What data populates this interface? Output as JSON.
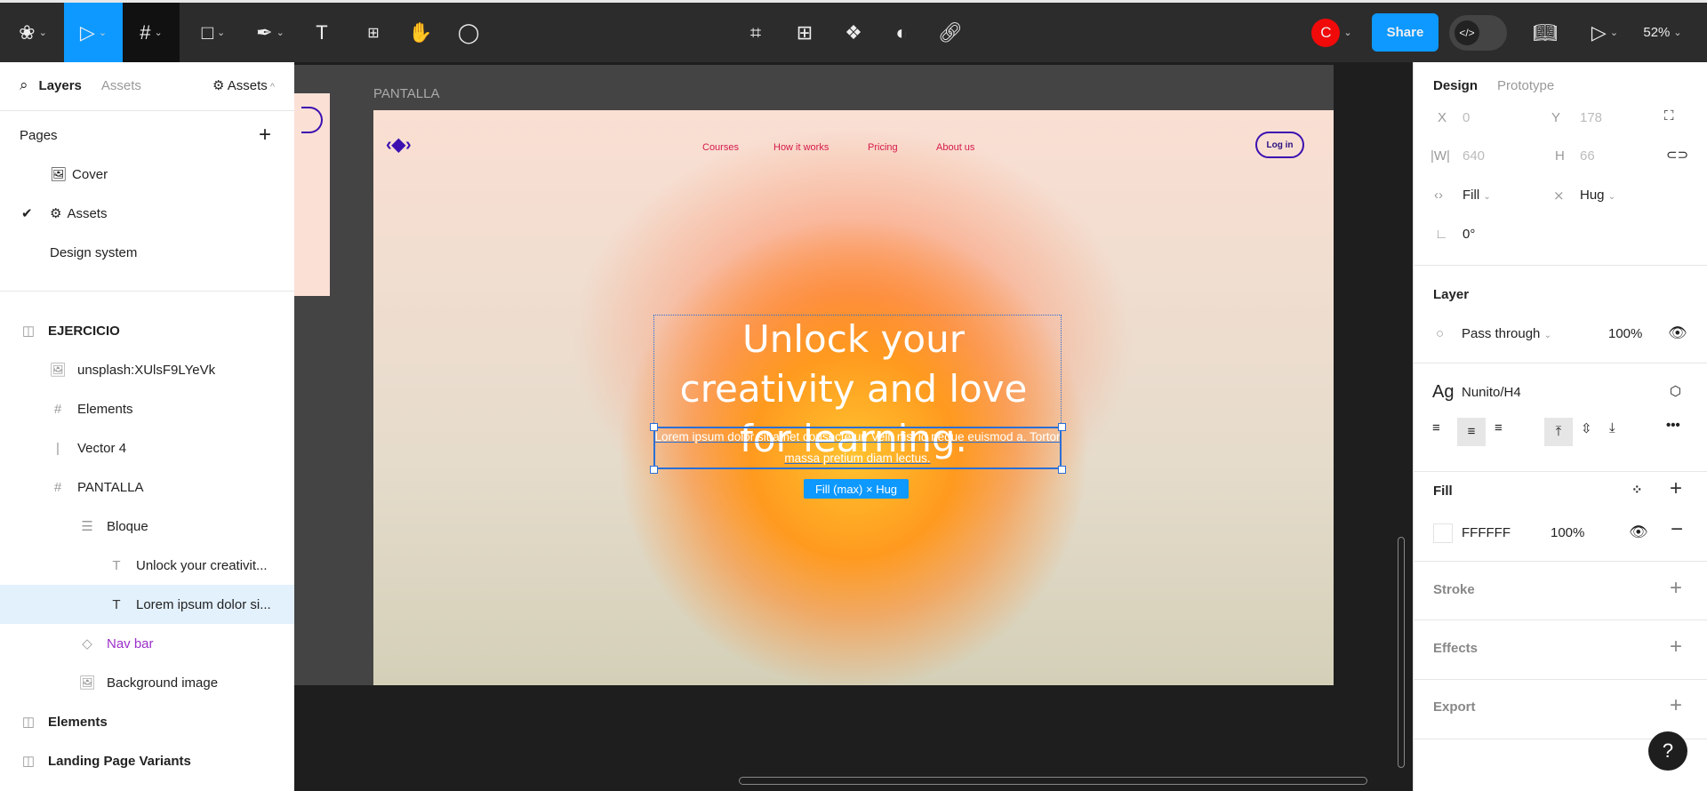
{
  "toolbar": {
    "zoom": "52%",
    "share": "Share",
    "avatar_initial": "C",
    "accent": "#0d99ff",
    "avatar_color": "#f00a0a"
  },
  "left": {
    "tabs": {
      "layers": "Layers",
      "assets": "Assets",
      "assets_dropdown": "Assets"
    },
    "pages_title": "Pages",
    "pages": [
      {
        "label": "Cover",
        "icon": "image-icon"
      },
      {
        "label": "Assets",
        "icon": "gear-icon",
        "active": true
      },
      {
        "label": "Design system"
      }
    ],
    "layers": [
      {
        "label": "EJERCICIO",
        "icon": "section-icon",
        "depth": 0,
        "bold": true
      },
      {
        "label": "unsplash:XUlsF9LYeVk",
        "icon": "image-icon",
        "depth": 1
      },
      {
        "label": "Elements",
        "icon": "frame-icon",
        "depth": 1
      },
      {
        "label": "Vector 4",
        "icon": "line-icon",
        "depth": 1
      },
      {
        "label": "PANTALLA",
        "icon": "frame-icon",
        "depth": 1
      },
      {
        "label": "Bloque",
        "icon": "autolayout-icon",
        "depth": 2
      },
      {
        "label": "Unlock your creativit...",
        "icon": "text-icon",
        "depth": 3
      },
      {
        "label": "Lorem ipsum dolor si...",
        "icon": "text-icon",
        "depth": 3,
        "selected": true
      },
      {
        "label": "Nav bar",
        "icon": "component-icon",
        "depth": 2,
        "purple": true
      },
      {
        "label": "Background image",
        "icon": "image-icon",
        "depth": 2
      },
      {
        "label": "Elements",
        "icon": "section-icon",
        "depth": 0,
        "bold": true
      },
      {
        "label": "Landing Page Variants",
        "icon": "section-icon",
        "depth": 0,
        "bold": true
      }
    ]
  },
  "canvas": {
    "frame_label": "PANTALLA",
    "nav": [
      "Courses",
      "How it works",
      "Pricing",
      "About us"
    ],
    "login": "Log in",
    "headline": "Unlock your creativity and love for learning.",
    "subtext": "Lorem ipsum dolor sit amet consectetur. Velit nisi id neque euismod a. Tortor massa pretium diam lectus.",
    "size_badge": "Fill (max) × Hug"
  },
  "right": {
    "tabs": {
      "design": "Design",
      "prototype": "Prototype"
    },
    "x_label": "X",
    "x": "0",
    "y_label": "Y",
    "y": "178",
    "w_label": "|W|",
    "w": "640",
    "h_label": "H",
    "h": "66",
    "width_mode": "Fill",
    "height_mode": "Hug",
    "rotation": "0°",
    "layer_title": "Layer",
    "blend": "Pass through",
    "opacity": "100%",
    "text_style_prefix": "Ag",
    "text_style": "Nunito/H4",
    "fill_title": "Fill",
    "fill_hex": "FFFFFF",
    "fill_opacity": "100%",
    "stroke_title": "Stroke",
    "effects_title": "Effects",
    "export_title": "Export"
  },
  "help": "?"
}
